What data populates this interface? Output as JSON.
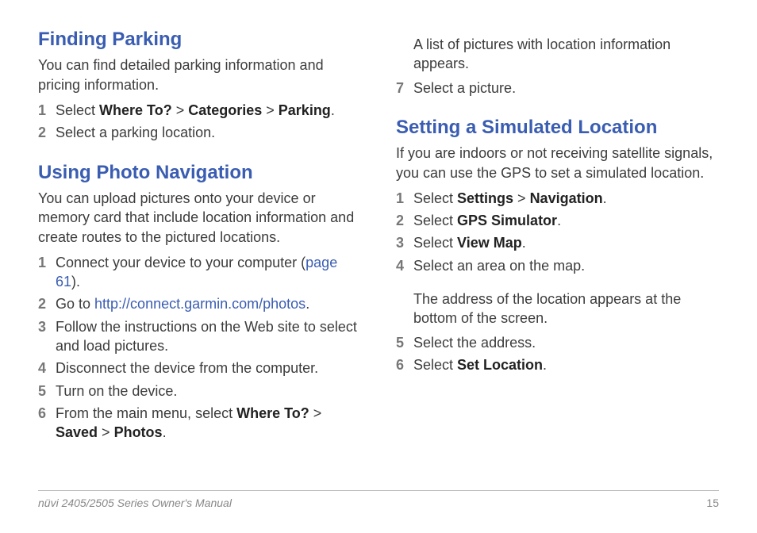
{
  "footer": {
    "left": "nüvi 2405/2505 Series Owner's Manual",
    "page": "15"
  },
  "leftCol": {
    "findParking": {
      "heading": "Finding Parking",
      "intro": "You can find detailed parking information and pricing information.",
      "steps": [
        {
          "num": "1",
          "pre": "Select ",
          "b1": "Where To?",
          "mid1": " > ",
          "b2": "Categories",
          "mid2": " > ",
          "b3": "Parking",
          "post": "."
        },
        {
          "num": "2",
          "plain": "Select a parking location."
        }
      ]
    },
    "photoNav": {
      "heading": "Using Photo Navigation",
      "intro": "You can upload pictures onto your device or memory card that include location information and create routes to the pictured locations.",
      "steps": {
        "s1": {
          "num": "1",
          "pre": "Connect your device to your computer (",
          "link": "page 61",
          "post": ")."
        },
        "s2": {
          "num": "2",
          "pre": "Go to ",
          "link": "http://connect.garmin.com/photos",
          "post": "."
        },
        "s3": {
          "num": "3",
          "plain": "Follow the instructions on the Web site to select and load pictures."
        },
        "s4": {
          "num": "4",
          "plain": "Disconnect the device from the computer."
        },
        "s5": {
          "num": "5",
          "plain": "Turn on the device."
        },
        "s6": {
          "num": "6",
          "pre": "From the main menu, select ",
          "b1": "Where To?",
          "mid1": " > ",
          "b2": "Saved",
          "mid2": " > ",
          "b3": "Photos",
          "post": "."
        }
      }
    }
  },
  "rightCol": {
    "photoNavCont": {
      "after6": "A list of pictures with location information appears.",
      "s7": {
        "num": "7",
        "plain": "Select a picture."
      }
    },
    "simLoc": {
      "heading": "Setting a Simulated Location",
      "intro": "If you are indoors or not receiving satellite signals, you can use the GPS to set a simulated location.",
      "steps": {
        "s1": {
          "num": "1",
          "pre": "Select ",
          "b1": "Settings",
          "mid1": " > ",
          "b2": "Navigation",
          "post": "."
        },
        "s2": {
          "num": "2",
          "pre": "Select ",
          "b1": "GPS Simulator",
          "post": "."
        },
        "s3": {
          "num": "3",
          "pre": "Select ",
          "b1": "View Map",
          "post": "."
        },
        "s4": {
          "num": "4",
          "plain": "Select an area on the map."
        },
        "after4": "The address of the location appears at the bottom of the screen.",
        "s5": {
          "num": "5",
          "plain": "Select the address."
        },
        "s6": {
          "num": "6",
          "pre": "Select ",
          "b1": "Set Location",
          "post": "."
        }
      }
    }
  }
}
